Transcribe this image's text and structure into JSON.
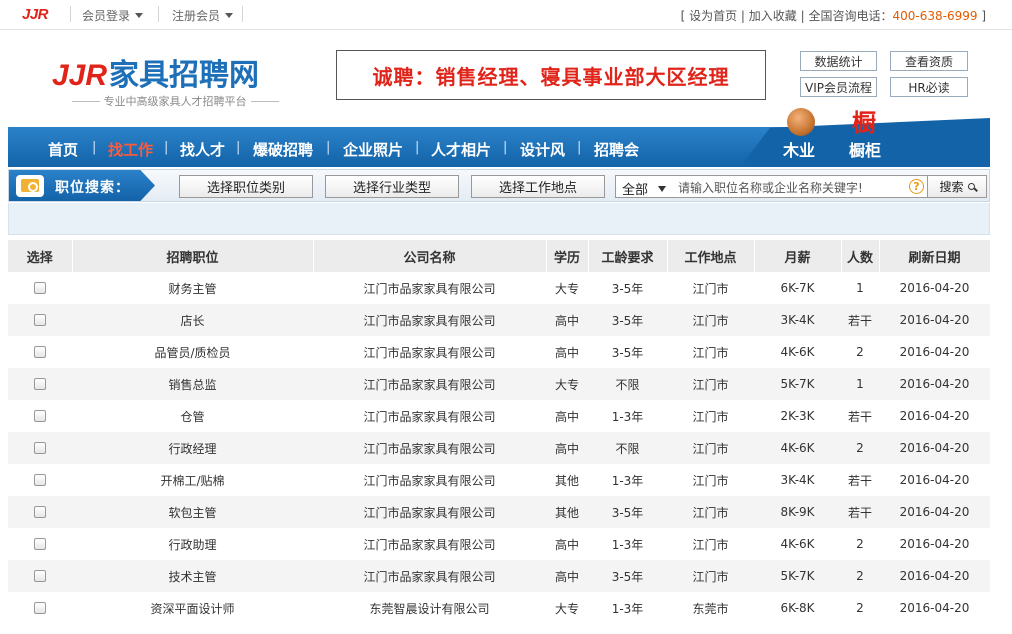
{
  "topbar": {
    "logo": "JJR",
    "member_login": "会员登录",
    "register": "注册会员",
    "right_prefix": "[",
    "set_home": "设为首页",
    "add_fav": "加入收藏",
    "hotline_label": "全国咨询电话：",
    "hotline": "400-638-6999",
    "right_suffix": "]"
  },
  "header": {
    "logo_latin": "JJR",
    "logo_cn": "家具招聘网",
    "tagline": "专业中高级家具人才招聘平台",
    "banner": "诚聘：销售经理、寝具事业部大区经理",
    "buttons": [
      "数据统计",
      "查看资质",
      "VIP会员流程",
      "HR必读"
    ]
  },
  "nav": {
    "items": [
      "首页",
      "找工作",
      "找人才",
      "爆破招聘",
      "企业照片",
      "人才相片",
      "设计风",
      "招聘会"
    ],
    "active_index": 1,
    "side": [
      "木业",
      "橱柜"
    ]
  },
  "search": {
    "title": "职位搜索：",
    "btn_category": "选择职位类别",
    "btn_industry": "选择行业类型",
    "btn_location": "选择工作地点",
    "scope": "全部",
    "placeholder": "请输入职位名称或企业名称关键字!",
    "help": "?",
    "submit": "搜索"
  },
  "table": {
    "headers": [
      "选择",
      "招聘职位",
      "公司名称",
      "学历",
      "工龄要求",
      "工作地点",
      "月薪",
      "人数",
      "刷新日期"
    ],
    "rows": [
      {
        "job": "财务主管",
        "company": "江门市品家家具有限公司",
        "edu": "大专",
        "exp": "3-5年",
        "loc": "江门市",
        "salary": "6K-7K",
        "count": "1",
        "date": "2016-04-20"
      },
      {
        "job": "店长",
        "company": "江门市品家家具有限公司",
        "edu": "高中",
        "exp": "3-5年",
        "loc": "江门市",
        "salary": "3K-4K",
        "count": "若干",
        "date": "2016-04-20"
      },
      {
        "job": "品管员/质检员",
        "company": "江门市品家家具有限公司",
        "edu": "高中",
        "exp": "3-5年",
        "loc": "江门市",
        "salary": "4K-6K",
        "count": "2",
        "date": "2016-04-20"
      },
      {
        "job": "销售总监",
        "company": "江门市品家家具有限公司",
        "edu": "大专",
        "exp": "不限",
        "loc": "江门市",
        "salary": "5K-7K",
        "count": "1",
        "date": "2016-04-20"
      },
      {
        "job": "仓管",
        "company": "江门市品家家具有限公司",
        "edu": "高中",
        "exp": "1-3年",
        "loc": "江门市",
        "salary": "2K-3K",
        "count": "若干",
        "date": "2016-04-20"
      },
      {
        "job": "行政经理",
        "company": "江门市品家家具有限公司",
        "edu": "高中",
        "exp": "不限",
        "loc": "江门市",
        "salary": "4K-6K",
        "count": "2",
        "date": "2016-04-20"
      },
      {
        "job": "开棉工/贴棉",
        "company": "江门市品家家具有限公司",
        "edu": "其他",
        "exp": "1-3年",
        "loc": "江门市",
        "salary": "3K-4K",
        "count": "若干",
        "date": "2016-04-20"
      },
      {
        "job": "软包主管",
        "company": "江门市品家家具有限公司",
        "edu": "其他",
        "exp": "3-5年",
        "loc": "江门市",
        "salary": "8K-9K",
        "count": "若干",
        "date": "2016-04-20"
      },
      {
        "job": "行政助理",
        "company": "江门市品家家具有限公司",
        "edu": "高中",
        "exp": "1-3年",
        "loc": "江门市",
        "salary": "4K-6K",
        "count": "2",
        "date": "2016-04-20"
      },
      {
        "job": "技术主管",
        "company": "江门市品家家具有限公司",
        "edu": "高中",
        "exp": "3-5年",
        "loc": "江门市",
        "salary": "5K-7K",
        "count": "2",
        "date": "2016-04-20"
      },
      {
        "job": "资深平面设计师",
        "company": "东莞智晨设计有限公司",
        "edu": "大专",
        "exp": "1-3年",
        "loc": "东莞市",
        "salary": "6K-8K",
        "count": "2",
        "date": "2016-04-20"
      }
    ]
  },
  "colors": {
    "brand_red": "#e0241a",
    "brand_blue": "#1363a8",
    "hotline": "#e65a00"
  }
}
